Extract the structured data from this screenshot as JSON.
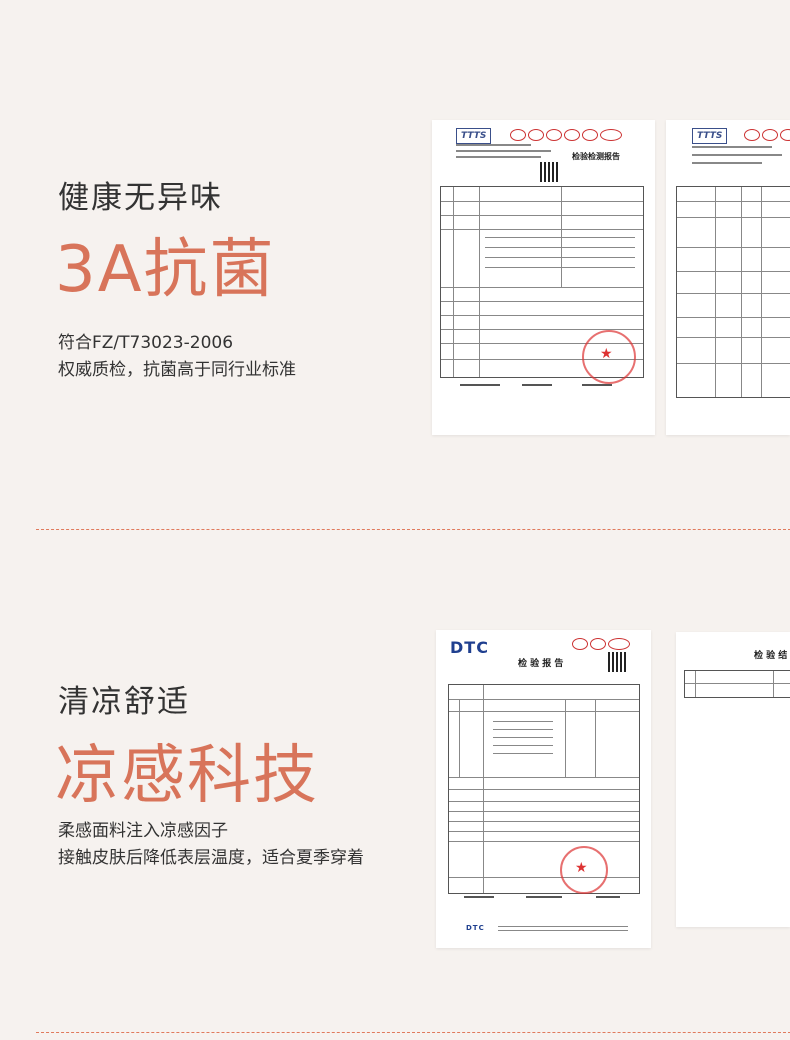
{
  "section1": {
    "heading": "健康无异味",
    "highlight": "3A抗菌",
    "desc_lines": [
      "符合FZ/T73023-2006",
      "权威质检，抗菌高于同行业标准"
    ],
    "doc1_title": "检验检测报告",
    "doc1_logo": "TTTS"
  },
  "section2": {
    "heading": "清凉舒适",
    "highlight": "凉感科技",
    "desc_lines": [
      "柔感面料注入凉感因子",
      "接触皮肤后降低表层温度，适合夏季穿着"
    ],
    "doc1_logo": "DTC",
    "doc1_title": "检 验 报 告",
    "doc2_title": "检 验 结"
  },
  "colors": {
    "accent": "#d8745a",
    "background": "#f6f2ef",
    "text": "#333333"
  }
}
